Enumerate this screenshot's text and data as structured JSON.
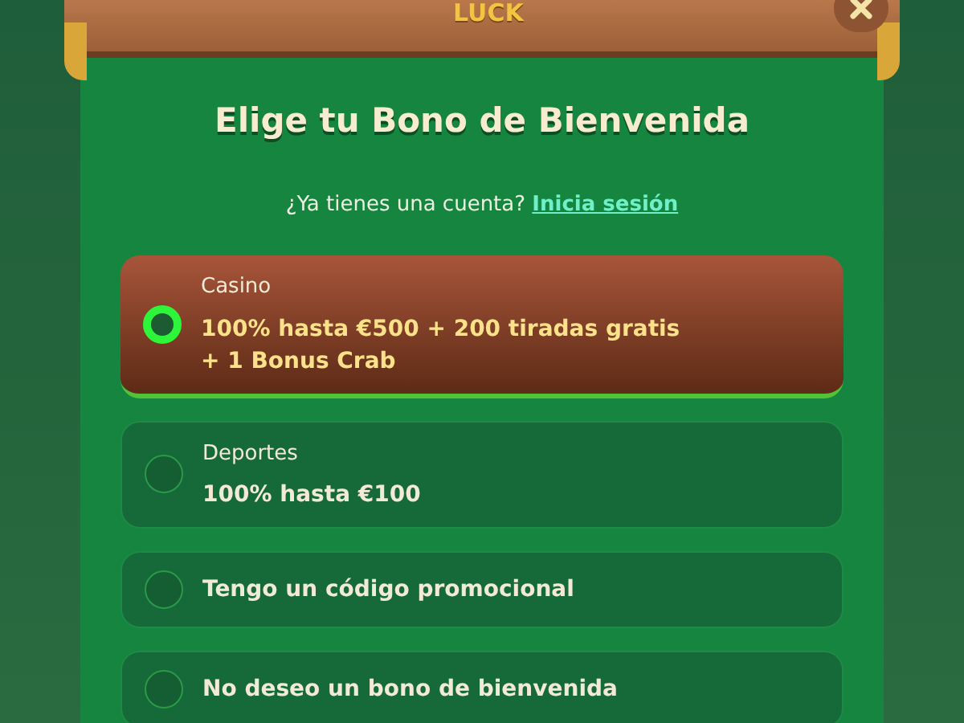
{
  "header": {
    "logo_text": "LUCK"
  },
  "title": "Elige tu Bono de Bienvenida",
  "login_prompt": {
    "text": "¿Ya tienes una cuenta?",
    "link": "Inicia sesión"
  },
  "options": [
    {
      "kind": "offer",
      "category": "Casino",
      "description": "100% hasta €500 + 200 tiradas gratis + 1 Bonus Crab",
      "selected": true
    },
    {
      "kind": "offer",
      "category": "Deportes",
      "description": "100% hasta €100",
      "selected": false
    },
    {
      "kind": "simple",
      "label": "Tengo un código promocional",
      "selected": false
    },
    {
      "kind": "simple",
      "label": "No deseo un bono de bienvenida",
      "selected": false
    }
  ]
}
